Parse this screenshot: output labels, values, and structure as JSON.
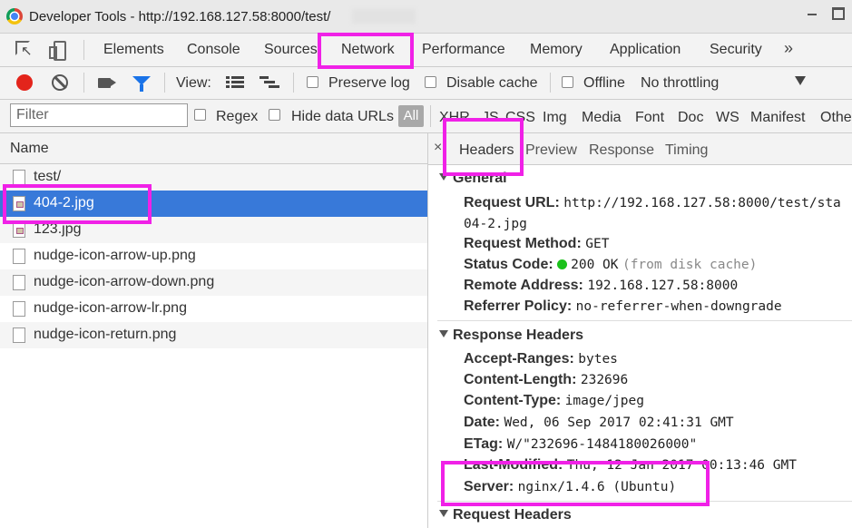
{
  "window": {
    "title": "Developer Tools - http://192.168.127.58:8000/test/",
    "icon": "chrome-icon"
  },
  "tabs": [
    "Elements",
    "Console",
    "Sources",
    "Network",
    "Performance",
    "Memory",
    "Application",
    "Security"
  ],
  "active_tab": "Network",
  "more_tabs": "»",
  "toolbar": {
    "view_label": "View:",
    "preserve_log": "Preserve log",
    "disable_cache": "Disable cache",
    "offline": "Offline",
    "throttling": "No throttling"
  },
  "filterbar": {
    "placeholder": "Filter",
    "regex": "Regex",
    "hide_data_urls": "Hide data URLs",
    "all": "All",
    "types": [
      "XHR",
      "JS",
      "CSS",
      "Img",
      "Media",
      "Font",
      "Doc",
      "WS",
      "Manifest",
      "Other"
    ]
  },
  "request_list": {
    "header": "Name",
    "rows": [
      {
        "name": "test/",
        "icon": "document-icon"
      },
      {
        "name": "404-2.jpg",
        "icon": "image-icon",
        "selected": true
      },
      {
        "name": "123.jpg",
        "icon": "image-icon"
      },
      {
        "name": "nudge-icon-arrow-up.png",
        "icon": "file-icon"
      },
      {
        "name": "nudge-icon-arrow-down.png",
        "icon": "file-icon"
      },
      {
        "name": "nudge-icon-arrow-lr.png",
        "icon": "file-icon"
      },
      {
        "name": "nudge-icon-return.png",
        "icon": "file-icon"
      }
    ]
  },
  "detail": {
    "close": "×",
    "tabs": [
      "Headers",
      "Preview",
      "Response",
      "Timing"
    ],
    "active_tab": "Headers",
    "general": {
      "title": "General",
      "request_url_key": "Request URL:",
      "request_url_value_1": "http://192.168.127.58:8000/test/sta",
      "request_url_value_2": "04-2.jpg",
      "method_key": "Request Method:",
      "method_value": "GET",
      "status_key": "Status Code:",
      "status_value": "200 OK",
      "status_note": "(from disk cache)",
      "remote_key": "Remote Address:",
      "remote_value": "192.168.127.58:8000",
      "referrer_key": "Referrer Policy:",
      "referrer_value": "no-referrer-when-downgrade"
    },
    "response_headers": {
      "title": "Response Headers",
      "items": [
        {
          "key": "Accept-Ranges:",
          "value": "bytes"
        },
        {
          "key": "Content-Length:",
          "value": "232696"
        },
        {
          "key": "Content-Type:",
          "value": "image/jpeg"
        },
        {
          "key": "Date:",
          "value": "Wed, 06 Sep 2017 02:41:31 GMT"
        },
        {
          "key": "ETag:",
          "value": "W/\"232696-1484180026000\""
        },
        {
          "key": "Last-Modified:",
          "value": "Thu, 12 Jan 2017 00:13:46 GMT"
        },
        {
          "key": "Server:",
          "value": "nginx/1.4.6 (Ubuntu)"
        }
      ]
    },
    "request_headers": {
      "title": "Request Headers"
    }
  },
  "colors": {
    "highlight": "#f021e7",
    "selection": "#3879d9",
    "record": "#e3241b",
    "filter_active": "#1a73e8",
    "status_ok": "#1bc11b"
  }
}
